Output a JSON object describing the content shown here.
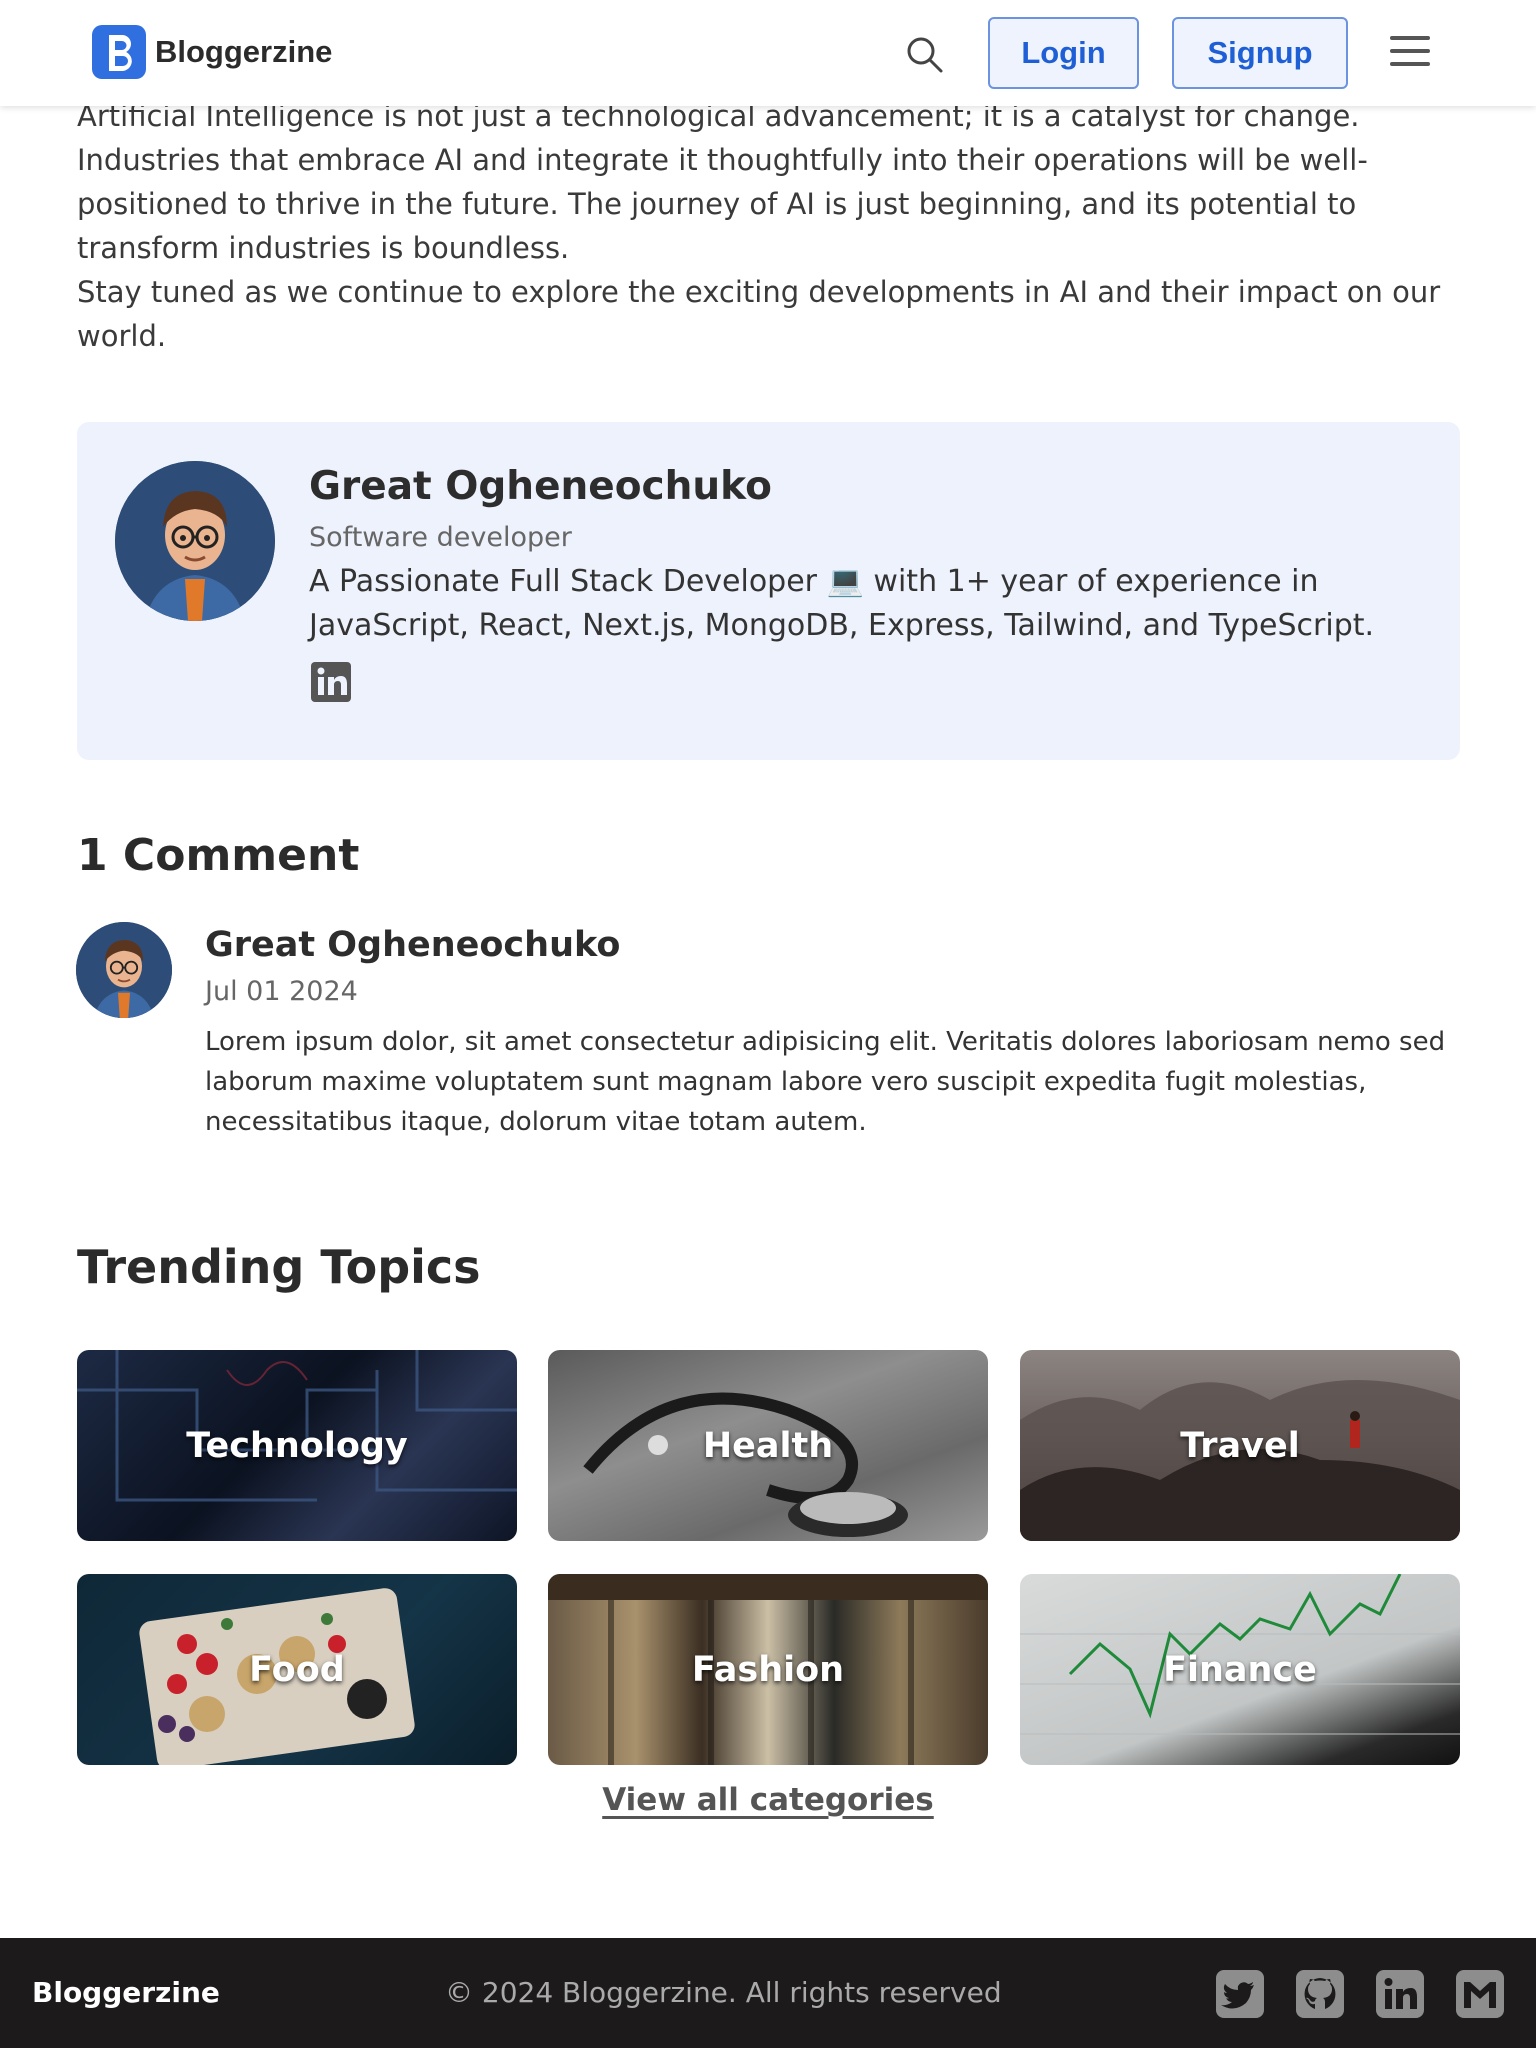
{
  "header": {
    "brand": "Bloggerzine",
    "login_label": "Login",
    "signup_label": "Signup",
    "icons": [
      "logo-b-icon",
      "search-icon",
      "hamburger-menu-icon"
    ]
  },
  "article": {
    "paragraph_1": "Artificial Intelligence is not just a technological advancement; it is a catalyst for change. Industries that embrace AI and integrate it thoughtfully into their operations will be well-positioned to thrive in the future. The journey of AI is just beginning, and its potential to transform industries is boundless.",
    "paragraph_2": "Stay tuned as we continue to explore the exciting developments in AI and their impact on our world."
  },
  "author": {
    "name": "Great Ogheneochuko",
    "role": "Software developer",
    "bio": "A Passionate Full Stack Developer 💻 with 1+ year of experience in JavaScript, React, Next.js, MongoDB, Express, Tailwind, and TypeScript.",
    "social_icon": "linkedin-icon"
  },
  "comments": {
    "title": "1 Comment",
    "items": [
      {
        "name": "Great Ogheneochuko",
        "date": "Jul 01 2024",
        "body": "Lorem ipsum dolor, sit amet consectetur adipisicing elit. Veritatis dolores laboriosam nemo sed laborum maxime voluptatem sunt magnam labore vero suscipit expedita fugit molestias, necessitatibus itaque, dolorum vitae totam autem."
      }
    ]
  },
  "trending": {
    "title": "Trending Topics",
    "topics": [
      {
        "label": "Technology"
      },
      {
        "label": "Health"
      },
      {
        "label": "Travel"
      },
      {
        "label": "Food"
      },
      {
        "label": "Fashion"
      },
      {
        "label": "Finance"
      }
    ],
    "view_all_label": "View all categories"
  },
  "footer": {
    "brand": "Bloggerzine",
    "copyright": "© 2024 Bloggerzine. All rights reserved",
    "icons": [
      "twitter-icon",
      "github-icon",
      "linkedin-icon",
      "gmail-icon"
    ]
  },
  "colors": {
    "accent": "#1f5fd6",
    "author_card_bg": "#eef2fc",
    "footer_bg": "#1c1a1a"
  }
}
